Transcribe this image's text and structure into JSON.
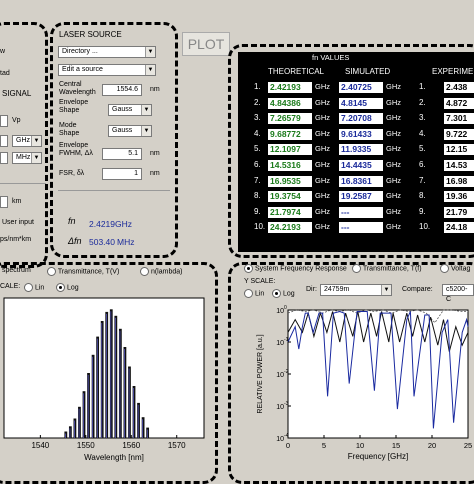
{
  "left_panel": {
    "labels": [
      "w",
      "tad",
      "SIGNAL",
      "Vp",
      "GHz",
      "MHz",
      "km",
      "User input",
      "ps/nm*km"
    ],
    "gbz_unit_combo": "GHz",
    "mhz_unit_combo": "MHz"
  },
  "laser": {
    "title": "LASER SOURCE",
    "directory": "Directory ...",
    "edit_source": "Edit a source",
    "central_wavelength_label": "Central Wavelength",
    "central_wavelength_value": "1554.6",
    "central_wavelength_unit": "nm",
    "envelope_shape_label": "Envelope Shape",
    "envelope_shape_value": "Gauss",
    "mode_shape_label": "Mode Shape",
    "mode_shape_value": "Gauss",
    "envelope_fwhm_label": "Envelope FWHM, Δλ",
    "envelope_fwhm_value": "5.1",
    "envelope_fwhm_unit": "nm",
    "fsr_label": "FSR, δλ",
    "fsr_value": "1",
    "fsr_unit": "nm",
    "fn_symbol": "fn",
    "fn_value": "2.4219GHz",
    "df_symbol": "Δfn",
    "df_value": "503.40",
    "df_unit": "MHz"
  },
  "plot_button": "PLOT",
  "values_table": {
    "title": "fn  VALUES",
    "headers": [
      "THEORETICAL",
      "SIMULATED",
      "EXPERIME"
    ],
    "unit": "GHz",
    "rows": [
      {
        "n": "1.",
        "theo": "2.42193",
        "sim": "2.40725",
        "exp": "2.438"
      },
      {
        "n": "2.",
        "theo": "4.84386",
        "sim": "4.8145",
        "exp": "4.872"
      },
      {
        "n": "3.",
        "theo": "7.26579",
        "sim": "7.20708",
        "exp": "7.301"
      },
      {
        "n": "4.",
        "theo": "9.68772",
        "sim": "9.61433",
        "exp": "9.722"
      },
      {
        "n": "5.",
        "theo": "12.1097",
        "sim": "11.9335",
        "exp": "12.15"
      },
      {
        "n": "6.",
        "theo": "14.5316",
        "sim": "14.4435",
        "exp": "14.53"
      },
      {
        "n": "7.",
        "theo": "16.9535",
        "sim": "16.8361",
        "exp": "16.98"
      },
      {
        "n": "8.",
        "theo": "19.3754",
        "sim": "19.2587",
        "exp": "19.36"
      },
      {
        "n": "9.",
        "theo": "21.7974",
        "sim": "---",
        "exp": "21.79"
      },
      {
        "n": "10.",
        "theo": "24.2193",
        "sim": "---",
        "exp": "24.18"
      }
    ]
  },
  "left_graph": {
    "radio_spectrum": "spectrum",
    "radio_transmittance": "Transmittance, T(V)",
    "radio_nlambda": "n(lambda)",
    "scale_label": "CALE:",
    "lin_label": "Lin",
    "log_label": "Log"
  },
  "right_graph": {
    "radio_sfr": "System Frequency Response",
    "radio_transmittance": "Transmittance, T(f)",
    "radio_voltage": "Voltag",
    "yscale_label": "Y SCALE:",
    "lin_label": "Lin",
    "log_label": "Log",
    "dir_label": "Dir:",
    "dir_value": "24759m",
    "compare_label": "Compare:",
    "compare_value": "c5200-C"
  },
  "chart_data": [
    {
      "type": "bar",
      "title": "",
      "xlabel": "Wavelength [nm]",
      "ylabel": "",
      "xticks": [
        "1540",
        "1550",
        "1560",
        "1570"
      ],
      "xlim": [
        1532,
        1576
      ],
      "x": [
        1545.6,
        1546.6,
        1547.6,
        1548.6,
        1549.6,
        1550.6,
        1551.6,
        1552.6,
        1553.6,
        1554.6,
        1555.6,
        1556.6,
        1557.6,
        1558.6,
        1559.6,
        1560.6,
        1561.6,
        1562.6,
        1563.6
      ],
      "values": [
        0.05,
        0.09,
        0.15,
        0.24,
        0.36,
        0.5,
        0.64,
        0.78,
        0.9,
        0.97,
        0.99,
        0.94,
        0.84,
        0.7,
        0.55,
        0.4,
        0.27,
        0.16,
        0.08
      ]
    },
    {
      "type": "line",
      "title": "",
      "xlabel": "Frequency [GHz]",
      "ylabel": "RELATIVE POWER [a.u.]",
      "yscale": "log",
      "ylim": [
        0.0001,
        1
      ],
      "xlim": [
        0,
        25
      ],
      "xticks": [
        "0",
        "5",
        "10",
        "15",
        "20",
        "25"
      ],
      "yticks": [
        "10^0",
        "10^-1",
        "10^-2",
        "10^-3",
        "10^-4"
      ],
      "series": [
        {
          "name": "",
          "color": "#1a2aa0",
          "x": [
            0,
            1,
            1.5,
            2,
            2.4,
            2.8,
            3.5,
            4.3,
            4.8,
            5.5,
            6.3,
            7.2,
            7.8,
            8.5,
            9.6,
            10.2,
            11,
            12,
            12.8,
            13.4,
            14.3,
            15.2,
            16.5,
            17,
            17.5,
            19,
            19.6,
            20.2,
            21.4,
            22.2,
            23,
            24.2,
            24.8,
            25
          ],
          "y": [
            0.1,
            0.3,
            0.06,
            0.3,
            0.8,
            0.8,
            0.2,
            0.8,
            0.8,
            0.002,
            0.8,
            0.9,
            0.8,
            0.005,
            0.9,
            0.9,
            0.9,
            0.003,
            0.8,
            0.8,
            0.8,
            0.0008,
            0.5,
            0.9,
            0.002,
            0.7,
            0.7,
            0.0002,
            0.2,
            0.5,
            0.0003,
            0.2,
            0.5,
            0.3
          ]
        },
        {
          "name": "",
          "color": "#111111",
          "x": [
            0,
            1,
            2,
            2.8,
            3.6,
            4.5,
            5.4,
            6.2,
            7.2,
            8,
            9,
            9.7,
            10.5,
            11.5,
            12.3,
            13,
            14,
            14.6,
            15.5,
            16.5,
            17.3,
            18,
            19,
            19.8,
            20.8,
            21.6,
            22.4,
            23.3,
            24.2,
            25
          ],
          "y": [
            0.2,
            0.5,
            0.2,
            0.8,
            0.15,
            0.8,
            0.2,
            0.9,
            0.1,
            0.8,
            0.15,
            0.9,
            0.1,
            0.8,
            0.15,
            0.9,
            0.1,
            0.8,
            0.1,
            0.8,
            0.15,
            0.7,
            0.1,
            0.6,
            0.08,
            0.5,
            0.05,
            0.3,
            0.08,
            0.2
          ]
        },
        {
          "name": "",
          "color": "#555555",
          "x": [
            0,
            1.2,
            2.4,
            3.6,
            4.8,
            6,
            7.2,
            8.4,
            9.6,
            10.8,
            12,
            13.2,
            14.4,
            15.6,
            16.8,
            18,
            19.2,
            20.4,
            21.6,
            22.8,
            24,
            25
          ],
          "y": [
            0.8,
            1,
            0.9,
            1,
            0.8,
            1,
            0.9,
            1,
            0.8,
            1,
            0.9,
            1,
            0.8,
            1,
            0.9,
            1,
            0.8,
            0.4,
            1,
            1,
            0.9,
            0.9
          ]
        }
      ]
    }
  ]
}
